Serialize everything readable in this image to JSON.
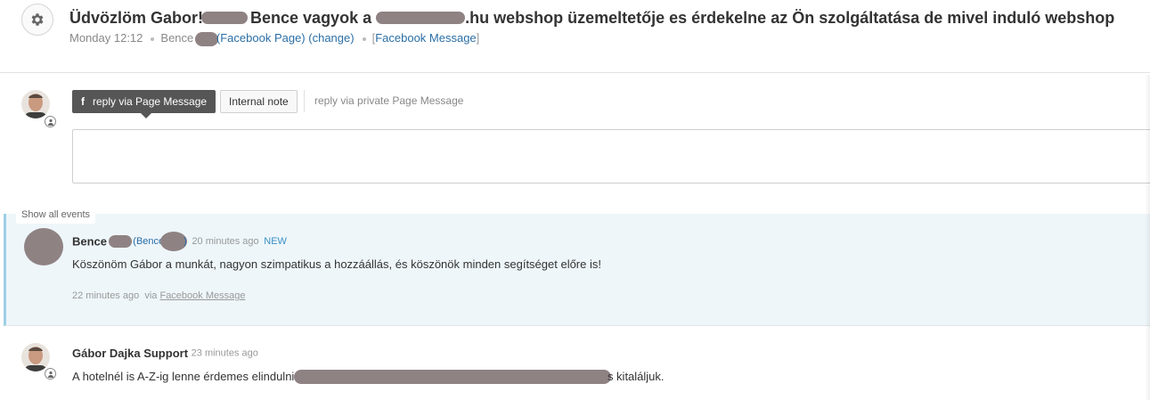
{
  "ticket": {
    "icon": "gear-icon",
    "subject_part1": "Üdvözlöm Gabor!",
    "subject_part2": " Bence vagyok a ",
    "subject_part3": ".hu webshop üzemeltetője es érdekelne az Ön szolgáltatása de mivel induló webshop",
    "date": "Monday 12:12",
    "requester_name": "Bence",
    "requester_source": "(Facebook Page)",
    "change_label": "(change)",
    "channel_open": "[",
    "channel": "Facebook Message",
    "channel_close": "]"
  },
  "composer": {
    "fb_icon": "f",
    "tab_reply": "reply via Page Message",
    "tab_note": "Internal note",
    "hint": "reply via private Page Message",
    "reply_placeholder": ""
  },
  "show_all_events": "Show all events",
  "events": [
    {
      "author": "Bence",
      "context": "(Bence",
      "context_tail": ")",
      "time": "20 minutes ago",
      "badge": "NEW",
      "body": "Köszönöm Gábor a munkát, nagyon szimpatikus a hozzáállás, és köszönök minden segítséget előre is!",
      "footer_time": "22 minutes ago",
      "footer_via": "via",
      "footer_channel": "Facebook Message"
    },
    {
      "author": "Gábor Dajka Support",
      "time": "23 minutes ago",
      "body_start": "A hotelnél is A-Z-ig lenne érdemes elindulni.",
      "body_end": "s kitaláljuk."
    }
  ],
  "colors": {
    "link": "#2a6ea6",
    "new_event_bg": "#eef6fa",
    "new_event_border": "#9fcfe6",
    "fb_tab_bg": "#565656",
    "redaction": "#8f8283"
  }
}
